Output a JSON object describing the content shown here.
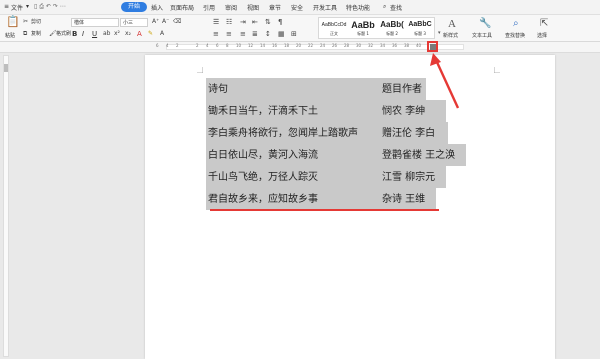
{
  "menubar": {
    "file": "文件",
    "tabs": [
      "开始",
      "插入",
      "页面布局",
      "引用",
      "审阅",
      "视图",
      "章节",
      "安全",
      "开发工具",
      "特色功能"
    ],
    "active_tab": "开始",
    "search": "查找"
  },
  "toolbar": {
    "paste": "粘贴",
    "cut": "剪切",
    "copy": "复制",
    "format_painter": "格式刷",
    "font_name": "楷体",
    "font_size": "小三",
    "bold": "B",
    "italic": "I",
    "underline": "U",
    "font_color": "A",
    "styles": [
      {
        "sample": "AaBbCcDd",
        "name": "正文"
      },
      {
        "sample": "AaBb",
        "name": "标题 1"
      },
      {
        "sample": "AaBb(",
        "name": "标题 2"
      },
      {
        "sample": "AaBbC",
        "name": "标题 3"
      }
    ],
    "new_style": "新样式",
    "text_tools": "文本工具",
    "find_replace": "查找替换",
    "select": "选择"
  },
  "ruler": {
    "numbers": [
      "6",
      "4",
      "2",
      "2",
      "4",
      "6",
      "8",
      "10",
      "12",
      "14",
      "16",
      "18",
      "20",
      "22",
      "24",
      "26",
      "28",
      "30",
      "32",
      "34",
      "36",
      "38",
      "40"
    ]
  },
  "document": {
    "header": {
      "title": "诗句",
      "author": "题目作者"
    },
    "rows": [
      {
        "line": "锄禾日当午，汗滴禾下土",
        "author": "悯农  李绅"
      },
      {
        "line": "李白乘舟将欲行，忽闻岸上踏歌声",
        "author": "赠汪伦  李白"
      },
      {
        "line": "白日依山尽，黄河入海流",
        "author": "登鹳雀楼  王之涣"
      },
      {
        "line": "千山鸟飞绝，万径人踪灭",
        "author": "江雪  柳宗元"
      },
      {
        "line": "君自故乡来，应知故乡事",
        "author": "杂诗  王维"
      }
    ]
  },
  "colors": {
    "accent": "#2f7de1",
    "annotation": "#e53935",
    "selection": "#c9c9c9"
  }
}
